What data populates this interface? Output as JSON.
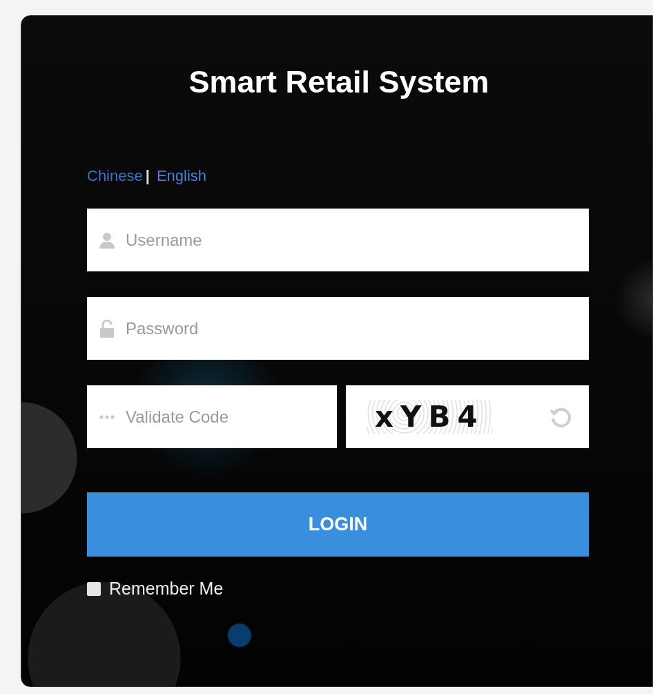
{
  "title": "Smart Retail System",
  "languages": [
    {
      "label": "Chinese",
      "selected": false
    },
    {
      "label": "English",
      "selected": true
    }
  ],
  "language_separator": "|",
  "username": {
    "placeholder": "Username"
  },
  "password": {
    "placeholder": "Password"
  },
  "validate_code": {
    "placeholder": "Validate Code"
  },
  "captcha_code": "xYB4",
  "login_button": "LOGIN",
  "remember_me": {
    "label": "Remember Me",
    "checked": false
  }
}
